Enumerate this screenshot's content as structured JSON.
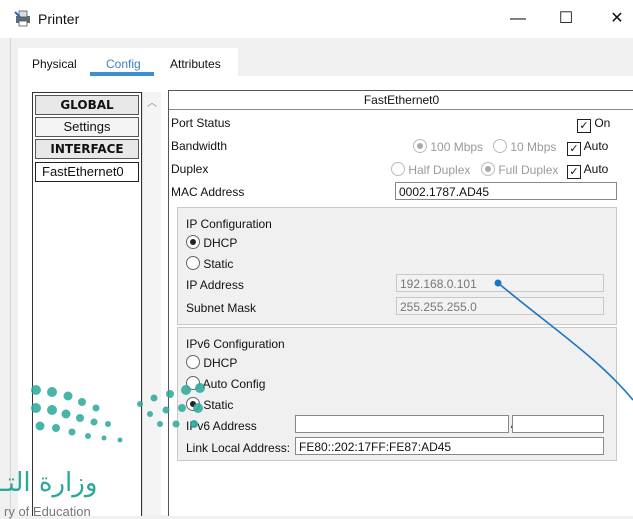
{
  "window": {
    "title": "Printer",
    "min_glyph": "—",
    "max_glyph": "☐",
    "close_glyph": "✕"
  },
  "tabs": [
    {
      "label": "Physical"
    },
    {
      "label": "Config"
    },
    {
      "label": "Attributes"
    }
  ],
  "sidebar": {
    "items": [
      {
        "label": "GLOBAL"
      },
      {
        "label": "Settings"
      },
      {
        "label": "INTERFACE"
      },
      {
        "label": "FastEthernet0"
      }
    ]
  },
  "panel": {
    "title": "FastEthernet0",
    "port_status": {
      "label": "Port Status",
      "on_label": "On",
      "checked": true
    },
    "bandwidth": {
      "label": "Bandwidth",
      "opt1": "100 Mbps",
      "opt2": "10 Mbps",
      "auto_label": "Auto",
      "auto_checked": true
    },
    "duplex": {
      "label": "Duplex",
      "opt1": "Half Duplex",
      "opt2": "Full Duplex",
      "auto_label": "Auto",
      "auto_checked": true
    },
    "mac": {
      "label": "MAC Address",
      "value": "0002.1787.AD45"
    },
    "ipv4": {
      "title": "IP Configuration",
      "dhcp_label": "DHCP",
      "static_label": "Static",
      "selected": "DHCP",
      "ip_label": "IP Address",
      "ip_value": "192.168.0.101",
      "mask_label": "Subnet Mask",
      "mask_value": "255.255.255.0"
    },
    "ipv6": {
      "title": "IPv6 Configuration",
      "dhcp_label": "DHCP",
      "auto_label": "Auto Config",
      "static_label": "Static",
      "selected": "Static",
      "addr_label": "IPv6 Address",
      "addr_value": "",
      "prefix_sep": "/",
      "prefix_value": "",
      "link_local_label": "Link Local Address:",
      "link_local_value": "FE80::202:17FF:FE87:AD45"
    }
  },
  "watermark": {
    "arabic": "وزارة التـ",
    "english": "ry of Education"
  },
  "colors": {
    "accent": "#3c8fd0",
    "watermark": "#2aa89b",
    "callout_line": "#1f74c1"
  }
}
